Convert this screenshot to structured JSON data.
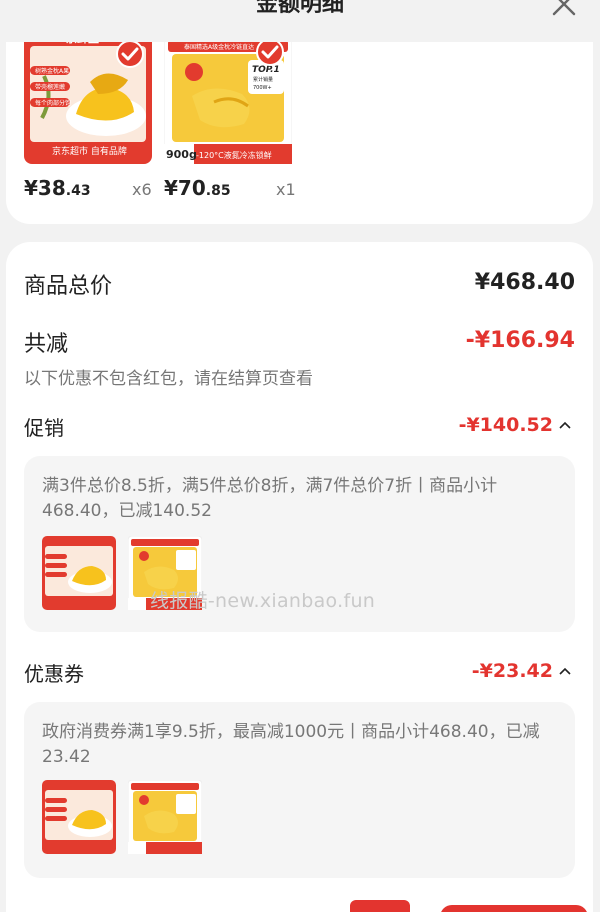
{
  "header": {
    "title": "金额明细"
  },
  "products": [
    {
      "image": "durian-jingxiansheng-pack",
      "brand": "京鲜生",
      "tags": [
        "树熟金枕A果",
        "带壳榴莲嫩",
        "每个肉部分饱"
      ],
      "footer": "京东超市 自有品牌",
      "price_int": "38",
      "price_dec": ".43",
      "qty": "x6",
      "currency": "¥"
    },
    {
      "image": "durian-frozen-pack",
      "banner": "泰国精选A级金枕冷链直达",
      "top_badge": "TOP.1",
      "top_sub": "累计销量",
      "top_count": "700W+",
      "weight": "900g",
      "weight_unit": "/袋",
      "footer": "-120°C液氮冷冻锁鲜",
      "price_int": "70",
      "price_dec": ".85",
      "qty": "x1",
      "currency": "¥"
    }
  ],
  "summary": {
    "total_label": "商品总价",
    "total_value": "¥468.40",
    "reduce_label": "共减",
    "reduce_value": "-¥166.94",
    "note": "以下优惠不包含红包，请在结算页查看",
    "promo": {
      "label": "促销",
      "value": "-¥140.52",
      "detail": "满3件总价8.5折，满5件总价8折，满7件总价7折丨商品小计468.40，已减140.52"
    },
    "coupon": {
      "label": "优惠券",
      "value": "-¥23.42",
      "detail": "政府消费券满1享9.5折，最高减1000元丨商品小计468.40，已减23.42"
    }
  },
  "watermark": "线报酷-new.xianbao.fun",
  "colors": {
    "accent": "#e3342f",
    "bg": "#f2f2f2",
    "card": "#ffffff"
  }
}
